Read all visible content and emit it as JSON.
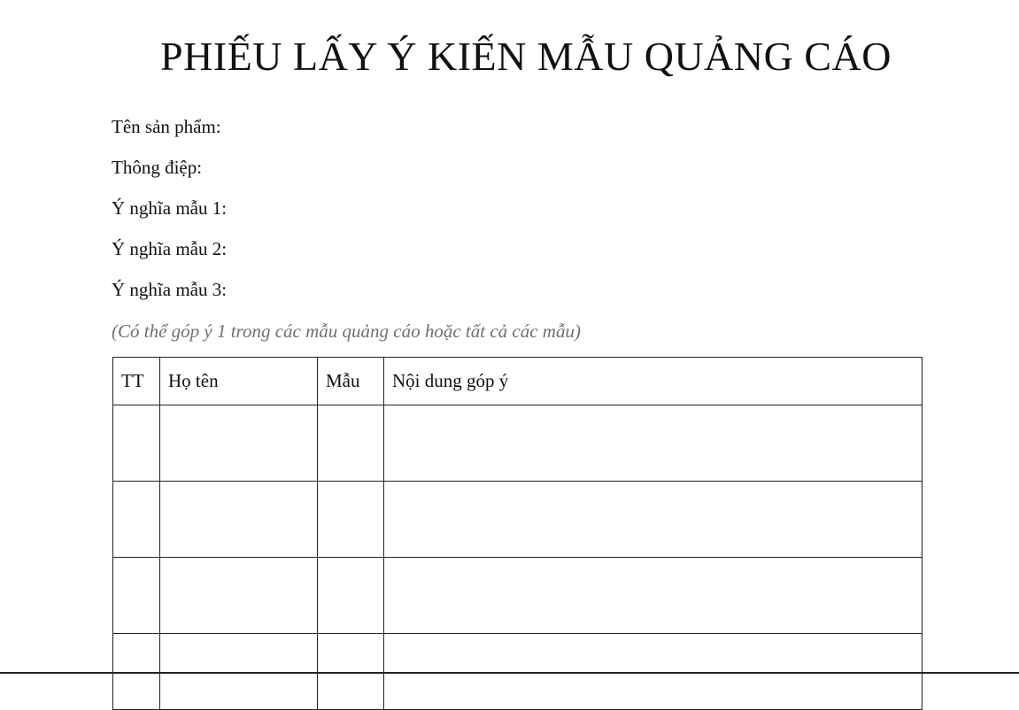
{
  "document": {
    "title": "PHIẾU LẤY Ý KIẾN MẪU QUẢNG CÁO",
    "fields": [
      {
        "label": "Tên sản phẩm:"
      },
      {
        "label": "Thông điệp:"
      },
      {
        "label": "Ý nghĩa mẫu 1:"
      },
      {
        "label": "Ý nghĩa mẫu 2:"
      },
      {
        "label": "Ý nghĩa mẫu 3:"
      }
    ],
    "note": "(Có thể góp ý 1 trong các mẫu quảng cáo hoặc tất cả các mẫu)"
  },
  "table": {
    "headers": {
      "tt": "TT",
      "name": "Họ tên",
      "sample": "Mẫu",
      "content": "Nội dung góp ý"
    },
    "rows": [
      {
        "tt": "",
        "name": "",
        "sample": "",
        "content": ""
      },
      {
        "tt": "",
        "name": "",
        "sample": "",
        "content": ""
      },
      {
        "tt": "",
        "name": "",
        "sample": "",
        "content": ""
      },
      {
        "tt": "",
        "name": "",
        "sample": "",
        "content": ""
      }
    ]
  }
}
